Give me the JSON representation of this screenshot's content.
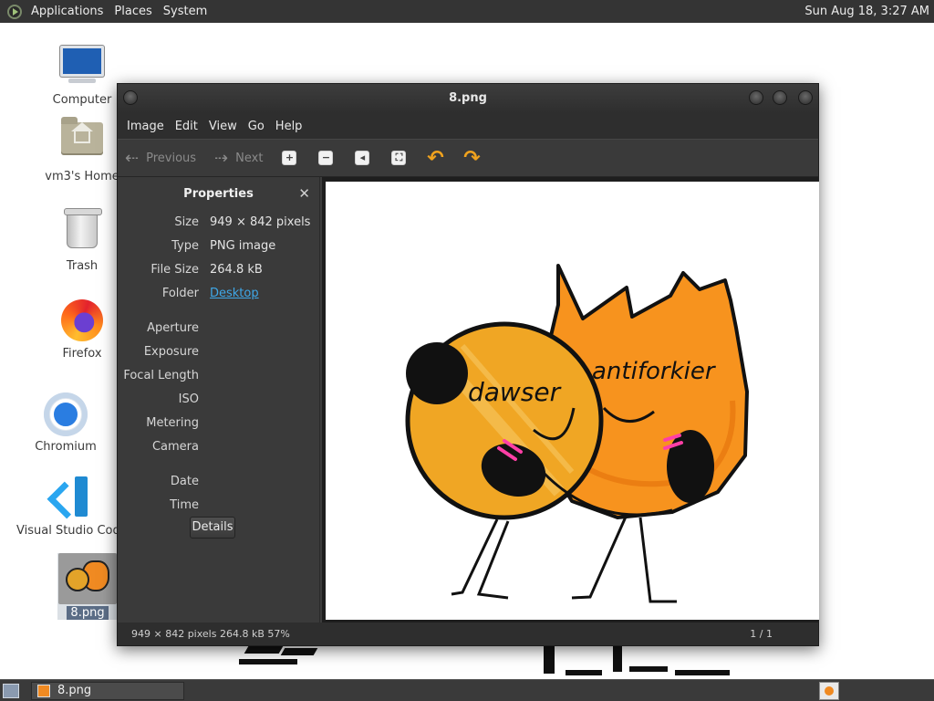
{
  "panel": {
    "menus": [
      "Applications",
      "Places",
      "System"
    ],
    "clock": "Sun Aug 18,  3:27 AM"
  },
  "desktop": {
    "icons": [
      {
        "label": "Computer",
        "icon": "computer-icon"
      },
      {
        "label": "vm3's Home",
        "icon": "home-folder-icon"
      },
      {
        "label": "Trash",
        "icon": "trash-icon"
      },
      {
        "label": "Firefox",
        "icon": "firefox-icon"
      },
      {
        "label": "Chromium",
        "icon": "chromium-icon"
      },
      {
        "label": "Visual Studio Code",
        "icon": "vscode-icon"
      },
      {
        "label": "8.png",
        "icon": "image-file-icon"
      }
    ]
  },
  "window": {
    "title": "8.png",
    "menu": [
      "Image",
      "Edit",
      "View",
      "Go",
      "Help"
    ],
    "toolbar": {
      "previous_label": "Previous",
      "next_label": "Next",
      "icons": [
        "zoom-in-icon",
        "zoom-out-icon",
        "best-fit-icon",
        "fullscreen-icon",
        "rotate-left-icon",
        "rotate-right-icon"
      ]
    },
    "sidebar": {
      "title": "Properties",
      "rows": [
        {
          "key": "Size",
          "value": "949 × 842 pixels"
        },
        {
          "key": "Type",
          "value": "PNG image"
        },
        {
          "key": "File Size",
          "value": "264.8 kB"
        },
        {
          "key": "Folder",
          "value": "Desktop"
        },
        {
          "key": "Aperture",
          "value": ""
        },
        {
          "key": "Exposure",
          "value": ""
        },
        {
          "key": "Focal Length",
          "value": ""
        },
        {
          "key": "ISO",
          "value": ""
        },
        {
          "key": "Metering",
          "value": ""
        },
        {
          "key": "Camera",
          "value": ""
        },
        {
          "key": "Date",
          "value": ""
        },
        {
          "key": "Time",
          "value": ""
        }
      ],
      "details_label": "Details"
    },
    "image": {
      "left_character_name": "dawser",
      "right_character_name": "antiforkier"
    },
    "status": {
      "info": "949 × 842 pixels  264.8 kB    57%",
      "page": "1 / 1"
    }
  },
  "taskbar": {
    "items": [
      {
        "label": "8.png"
      }
    ]
  }
}
